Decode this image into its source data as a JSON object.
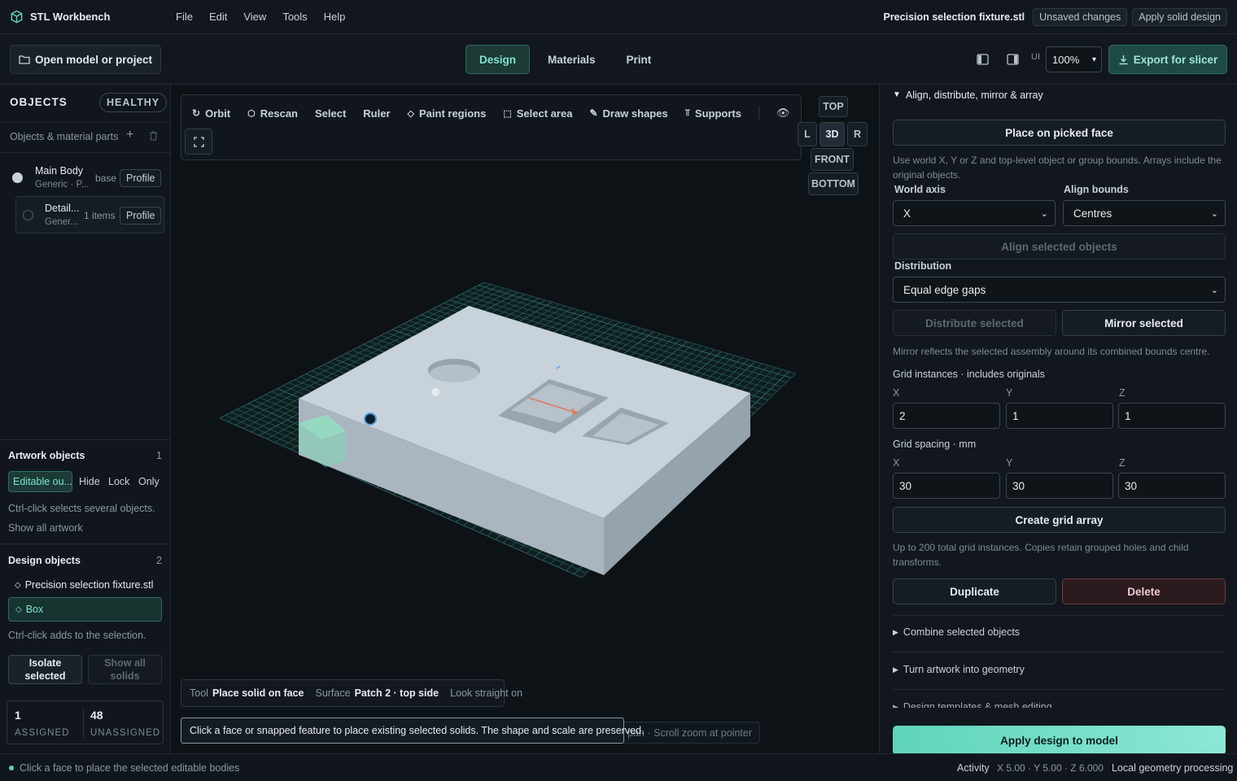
{
  "app": {
    "name": "STL Workbench"
  },
  "menu": [
    "File",
    "Edit",
    "View",
    "Tools",
    "Help"
  ],
  "header": {
    "file_name": "Precision selection fixture.stl",
    "unsaved": "Unsaved changes",
    "apply_solid": "Apply solid design"
  },
  "toolbar": {
    "open_label": "Open model or project",
    "tabs": [
      "Design",
      "Materials",
      "Print"
    ],
    "active_tab": "Design",
    "ui_label": "UI",
    "zoom": "100%",
    "export_label": "Export for slicer"
  },
  "left": {
    "objects_title": "OBJECTS",
    "health": "HEALTHY",
    "parts_label": "Objects & material parts",
    "items": [
      {
        "name": "Main Body",
        "sub": "Generic · P...",
        "tag": "base",
        "profile": "Profile"
      },
      {
        "name": "Detail...",
        "sub": "Gener...",
        "tag": "1 items",
        "profile": "Profile"
      }
    ],
    "artwork": {
      "title": "Artwork objects",
      "count": "1",
      "editable": "Editable ou...",
      "hide": "Hide",
      "lock": "Lock",
      "only": "Only",
      "hint": "Ctrl-click selects several objects.",
      "show_all": "Show all artwork"
    },
    "design": {
      "title": "Design objects",
      "count": "2",
      "items": [
        "Precision selection fixture.stl",
        "Box"
      ],
      "hint": "Ctrl-click adds to the selection.",
      "isolate": "Isolate selected",
      "show_all": "Show all solids"
    },
    "stats": {
      "assigned_n": "1",
      "assigned": "ASSIGNED",
      "unassigned_n": "48",
      "unassigned": "UNASSIGNED"
    }
  },
  "viewport": {
    "tools": [
      "Orbit",
      "Rescan",
      "Select",
      "Ruler",
      "Paint regions",
      "Select area",
      "Draw shapes",
      "Supports"
    ],
    "views": {
      "top": "TOP",
      "l": "L",
      "iso": "3D",
      "r": "R",
      "front": "FRONT",
      "bottom": "BOTTOM"
    },
    "info": {
      "tool_k": "Tool",
      "tool_v": "Place solid on face",
      "surf_k": "Surface",
      "surf_v": "Patch 2 · top side",
      "look": "Look straight on"
    },
    "tooltip": "Click a face or snapped feature to place existing selected solids. The shape and scale are preserved.",
    "hint_tail": "g pan · Scroll zoom at pointer"
  },
  "right": {
    "section_title": "Align, distribute, mirror & array",
    "place_face": "Place on picked face",
    "note1": "Use world X, Y or Z and top-level object or group bounds. Arrays include the original objects.",
    "world_axis_label": "World axis",
    "world_axis": "X",
    "align_bounds_label": "Align bounds",
    "align_bounds": "Centres",
    "align_btn": "Align selected objects",
    "distribution_label": "Distribution",
    "distribution": "Equal edge gaps",
    "distribute_btn": "Distribute selected",
    "mirror_btn": "Mirror selected",
    "mirror_note": "Mirror reflects the selected assembly around its combined bounds centre.",
    "grid_label": "Grid instances · includes originals",
    "grid": {
      "x": "2",
      "y": "1",
      "z": "1"
    },
    "spacing_label": "Grid spacing · mm",
    "spacing": {
      "x": "30",
      "y": "30",
      "z": "30"
    },
    "axis_x": "X",
    "axis_y": "Y",
    "axis_z": "Z",
    "create_grid": "Create grid array",
    "grid_note": "Up to 200 total grid instances. Copies retain grouped holes and child transforms.",
    "duplicate": "Duplicate",
    "delete": "Delete",
    "combine": "Combine selected objects",
    "artwork_geom": "Turn artwork into geometry",
    "templates": "Design templates & mesh editing",
    "apply": "Apply design to model"
  },
  "status": {
    "message": "Click a face to place the selected editable bodies",
    "activity": "Activity",
    "coords": "X 5.00 · Y 5.00 · Z 6.000",
    "local": "Local geometry processing"
  },
  "colors": {
    "accent": "#5fd4bb",
    "bg": "#0f1419",
    "delete": "#e07a7a"
  }
}
